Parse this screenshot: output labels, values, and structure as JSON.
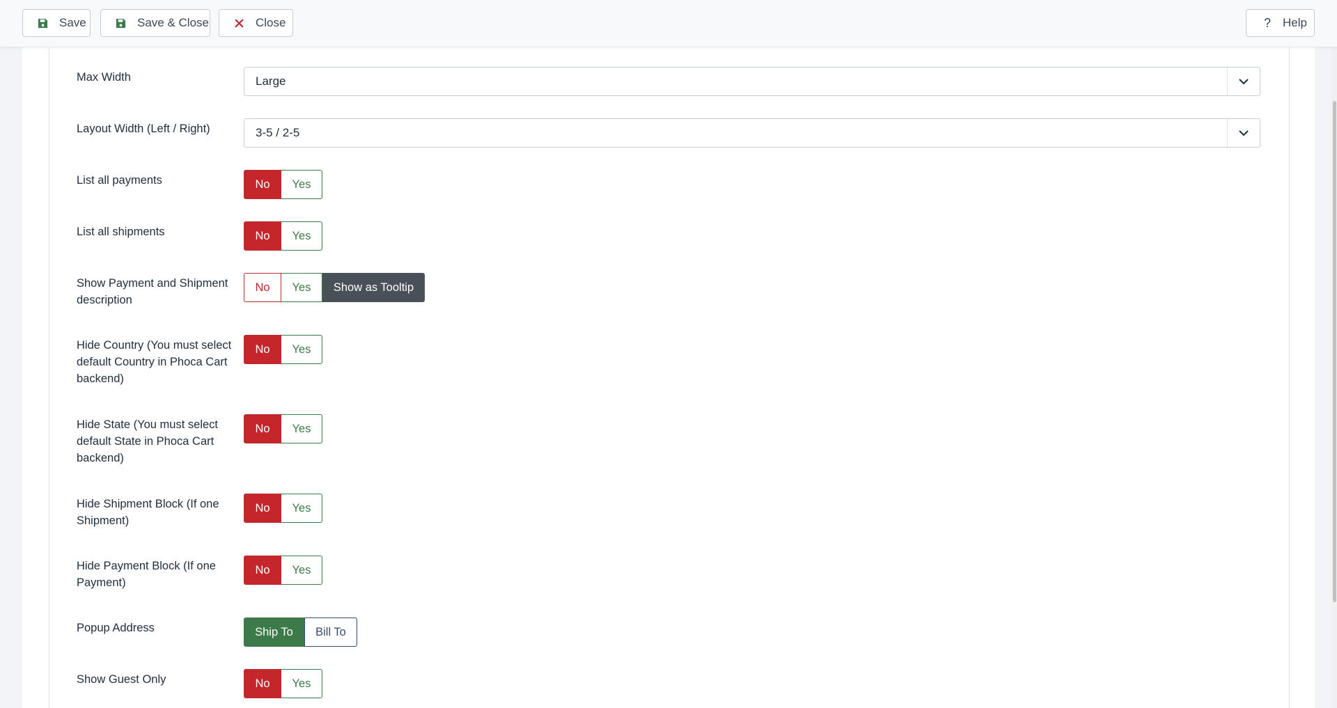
{
  "toolbar": {
    "save_label": "Save",
    "save_close_label": "Save & Close",
    "close_label": "Close",
    "help_label": "Help"
  },
  "fields": {
    "max_width": {
      "label": "Max Width",
      "value": "Large"
    },
    "layout_width": {
      "label": "Layout Width (Left / Right)",
      "value": "3-5 / 2-5"
    },
    "list_payments": {
      "label": "List all payments",
      "no": "No",
      "yes": "Yes",
      "selected": "No"
    },
    "list_shipments": {
      "label": "List all shipments",
      "no": "No",
      "yes": "Yes",
      "selected": "No"
    },
    "show_desc": {
      "label": "Show Payment and Shipment description",
      "no": "No",
      "yes": "Yes",
      "tooltip": "Show as Tooltip",
      "selected": "Show as Tooltip"
    },
    "hide_country": {
      "label": "Hide Country (You must select default Country in Phoca Cart backend)",
      "no": "No",
      "yes": "Yes",
      "selected": "No"
    },
    "hide_state": {
      "label": "Hide State (You must select default State in Phoca Cart backend)",
      "no": "No",
      "yes": "Yes",
      "selected": "No"
    },
    "hide_shipment_block": {
      "label": "Hide Shipment Block (If one Shipment)",
      "no": "No",
      "yes": "Yes",
      "selected": "No"
    },
    "hide_payment_block": {
      "label": "Hide Payment Block (If one Payment)",
      "no": "No",
      "yes": "Yes",
      "selected": "No"
    },
    "popup_address": {
      "label": "Popup Address",
      "ship": "Ship To",
      "bill": "Bill To",
      "selected": "Ship To"
    },
    "show_guest": {
      "label": "Show Guest Only",
      "no": "No",
      "yes": "Yes",
      "selected": "No"
    }
  },
  "icons": {
    "save": "floppy-disk-icon",
    "close": "x-icon",
    "help": "question-icon",
    "select": "chevron-down-icon"
  },
  "colors": {
    "danger": "#c4262b",
    "success": "#3d7a4a",
    "dark": "#495057",
    "primary": "#344b6a"
  }
}
